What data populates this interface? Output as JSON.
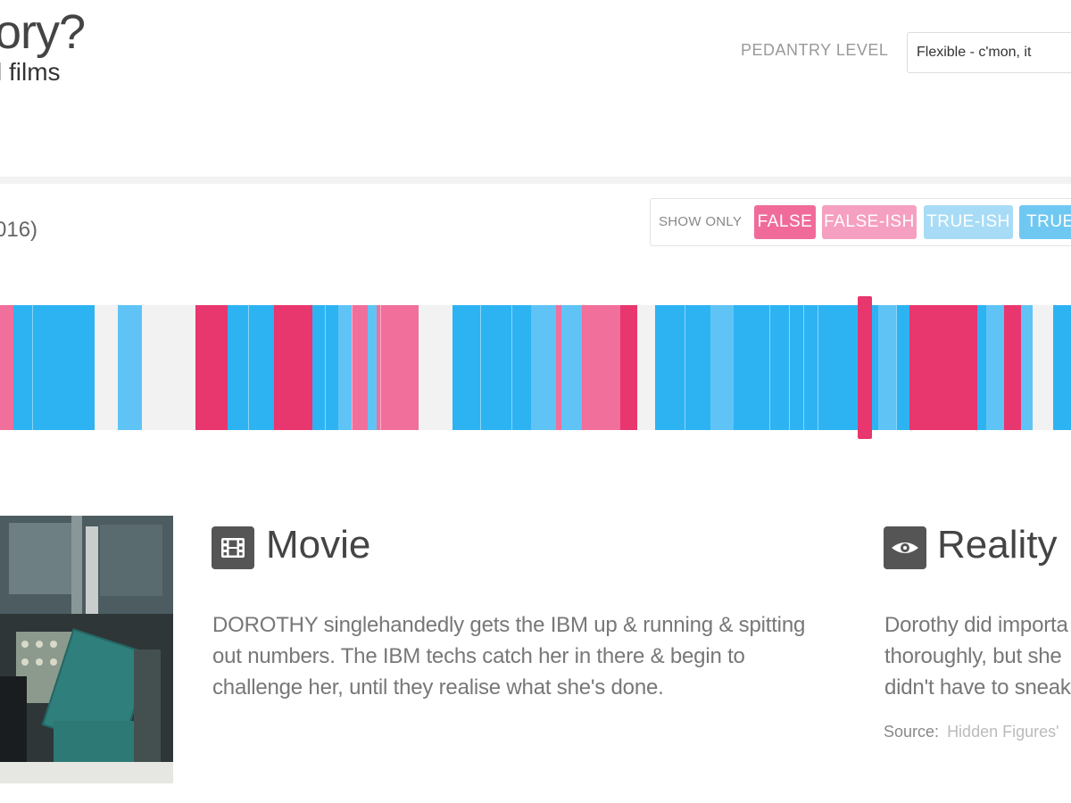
{
  "header": {
    "title": "ory?",
    "subtitle": "l films",
    "pedantry_label": "PEDANTRY LEVEL",
    "pedantry_value": "Flexible - c'mon, it"
  },
  "film": {
    "year_text": "016)"
  },
  "filter": {
    "show_only_label": "SHOW ONLY",
    "buttons": [
      {
        "label": "FALSE",
        "color": "#f06b9a"
      },
      {
        "label": "FALSE-ISH",
        "color": "#f5a0c0"
      },
      {
        "label": "TRUE-ISH",
        "color": "#a8dcf6"
      },
      {
        "label": "TRUE",
        "color": "#6fc8f2"
      }
    ]
  },
  "colors": {
    "false": "#e8366e",
    "false_ish": "#f06f9b",
    "true_ish": "#5fc4f5",
    "true": "#2db3f2",
    "unknown": "#f2f2f2"
  },
  "scene_stripes": [
    {
      "verdict": "false_ish",
      "weight": 1.8
    },
    {
      "verdict": "true",
      "weight": 11.2
    },
    {
      "verdict": "unknown",
      "weight": 3.2
    },
    {
      "verdict": "true_ish",
      "weight": 3.2
    },
    {
      "verdict": "unknown",
      "weight": 7.4
    },
    {
      "verdict": "false",
      "weight": 4.4
    },
    {
      "verdict": "true",
      "weight": 6.4
    },
    {
      "verdict": "false",
      "weight": 5.2
    },
    {
      "verdict": "true",
      "weight": 3.6
    },
    {
      "verdict": "true_ish",
      "weight": 1.8
    },
    {
      "verdict": "false_ish",
      "weight": 2.2
    },
    {
      "verdict": "true_ish",
      "weight": 1.2
    },
    {
      "verdict": "false_ish",
      "weight": 5.8
    },
    {
      "verdict": "unknown",
      "weight": 4.6
    },
    {
      "verdict": "true",
      "weight": 10.8
    },
    {
      "verdict": "true_ish",
      "weight": 3.4
    },
    {
      "verdict": "false_ish",
      "weight": 0.8
    },
    {
      "verdict": "true_ish",
      "weight": 2.8
    },
    {
      "verdict": "false_ish",
      "weight": 5.2
    },
    {
      "verdict": "false",
      "weight": 2.4
    },
    {
      "verdict": "unknown",
      "weight": 2.4
    },
    {
      "verdict": "true",
      "weight": 7.6
    },
    {
      "verdict": "true_ish",
      "weight": 3.2
    },
    {
      "verdict": "true",
      "weight": 19.8
    },
    {
      "verdict": "true_ish",
      "weight": 2.4
    },
    {
      "verdict": "true",
      "weight": 1.8
    },
    {
      "verdict": "false",
      "weight": 9.4
    },
    {
      "verdict": "true",
      "weight": 1.2
    },
    {
      "verdict": "true_ish",
      "weight": 2.4
    },
    {
      "verdict": "false",
      "weight": 2.4
    },
    {
      "verdict": "true_ish",
      "weight": 1.6
    },
    {
      "verdict": "unknown",
      "weight": 2.8
    },
    {
      "verdict": "true",
      "weight": 2.4
    }
  ],
  "movie": {
    "title": "Movie",
    "text": "DOROTHY singlehandedly gets the IBM up & running & spitting out numbers. The IBM techs catch her in there & begin to challenge her, until they realise what she's done."
  },
  "reality": {
    "title": "Reality",
    "line1": "Dorothy did importa",
    "line2": "thoroughly, but she",
    "line3": "didn't have to sneak",
    "source_label": "Source:",
    "source_link": "Hidden Figures' ",
    "source_color": "#bbbbbb"
  }
}
